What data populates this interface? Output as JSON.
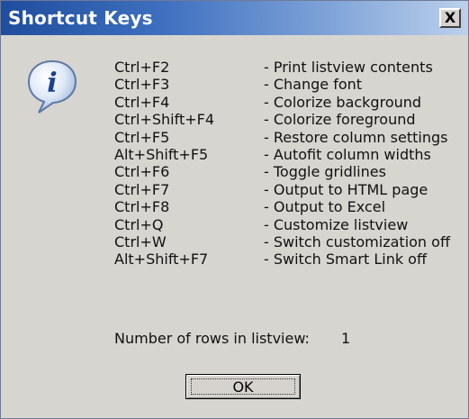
{
  "window": {
    "title": "Shortcut Keys",
    "close_glyph": "X"
  },
  "icon": {
    "name": "info-icon",
    "glyph": "i"
  },
  "shortcuts": [
    {
      "key": "Ctrl+F2",
      "desc": "- Print listview contents"
    },
    {
      "key": "Ctrl+F3",
      "desc": "- Change font"
    },
    {
      "key": "Ctrl+F4",
      "desc": "- Colorize background"
    },
    {
      "key": "Ctrl+Shift+F4",
      "desc": "- Colorize foreground"
    },
    {
      "key": "Ctrl+F5",
      "desc": "- Restore column settings"
    },
    {
      "key": "Alt+Shift+F5",
      "desc": "- Autofit column widths"
    },
    {
      "key": "Ctrl+F6",
      "desc": "- Toggle gridlines"
    },
    {
      "key": "Ctrl+F7",
      "desc": "- Output to HTML page"
    },
    {
      "key": "Ctrl+F8",
      "desc": "- Output to Excel"
    },
    {
      "key": "Ctrl+Q",
      "desc": "- Customize listview"
    },
    {
      "key": "Ctrl+W",
      "desc": "- Switch customization off"
    },
    {
      "key": "Alt+Shift+F7",
      "desc": "- Switch Smart Link off"
    }
  ],
  "rows": {
    "label": "Number of rows in listview:",
    "value": "1"
  },
  "buttons": {
    "ok": "OK"
  },
  "colors": {
    "titlebar_start": "#1f4d9e",
    "titlebar_end": "#bcd0ec",
    "dialog_bg": "#d7d5d0"
  }
}
